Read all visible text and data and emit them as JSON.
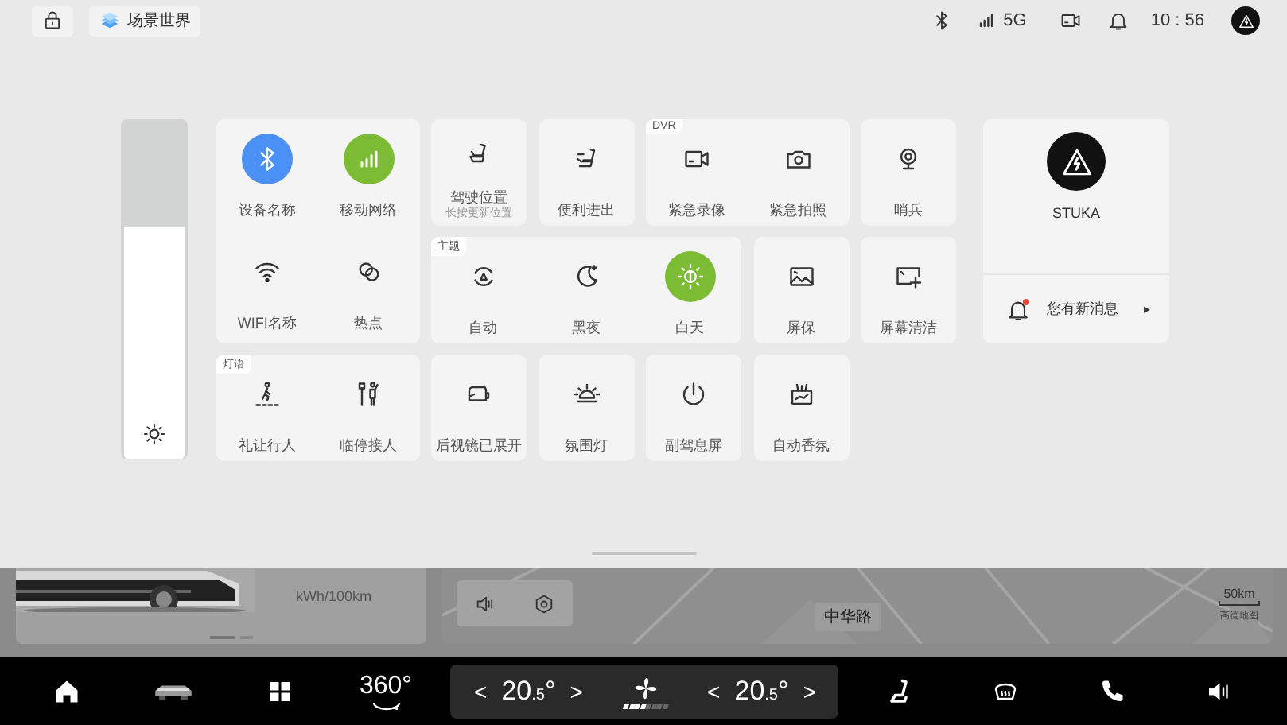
{
  "status_bar": {
    "scene_button": "场景世界",
    "network": "5G",
    "time": "10 : 56"
  },
  "brightness": {
    "level": 0.68
  },
  "cards": [
    {
      "items": [
        {
          "label": "设备名称",
          "on": true,
          "color": "#4a90f5"
        },
        {
          "label": "移动网络",
          "on": true,
          "color": "#7cbc35"
        },
        {
          "label": "WIFI名称",
          "on": false
        },
        {
          "label": "热点",
          "on": false
        }
      ]
    },
    {
      "items": [
        {
          "label": "驾驶位置",
          "sublabel": "长按更新位置"
        }
      ]
    },
    {
      "items": [
        {
          "label": "便利进出"
        }
      ]
    },
    {
      "tag": "DVR",
      "items": [
        {
          "label": "紧急录像"
        },
        {
          "label": "紧急拍照"
        }
      ]
    },
    {
      "items": [
        {
          "label": "哨兵"
        }
      ]
    },
    {
      "tag": "主题",
      "items": [
        {
          "label": "自动",
          "selected": false
        },
        {
          "label": "黑夜",
          "selected": false
        },
        {
          "label": "白天",
          "selected": true
        }
      ]
    },
    {
      "items": [
        {
          "label": "屏保"
        }
      ]
    },
    {
      "items": [
        {
          "label": "屏幕清洁"
        }
      ]
    },
    {
      "tag": "灯语",
      "items": [
        {
          "label": "礼让行人"
        },
        {
          "label": "临停接人"
        }
      ]
    },
    {
      "items": [
        {
          "label": "后视镜已展开"
        }
      ]
    },
    {
      "items": [
        {
          "label": "氛围灯"
        }
      ]
    },
    {
      "items": [
        {
          "label": "副驾息屏"
        }
      ]
    },
    {
      "items": [
        {
          "label": "自动香氛"
        }
      ]
    }
  ],
  "profile": {
    "name": "STUKA",
    "notification": "您有新消息",
    "arrow": "▸",
    "unread": true
  },
  "background": {
    "consumption_unit": "kWh/100km",
    "page_dots": [
      {
        "selected": true
      },
      {
        "selected": false
      }
    ],
    "road": "中华路",
    "scale": "50km",
    "map_brand": "高德地图"
  },
  "dock": {
    "view_360": "360°",
    "climate": {
      "left_down": "<",
      "left_temp": "20$_{.5}$°",
      "left_up": ">",
      "fan": {
        "level": 0.5
      },
      "right_down": "<",
      "right_temp": "20$_{.5}$°",
      "right_up": ">"
    }
  }
}
